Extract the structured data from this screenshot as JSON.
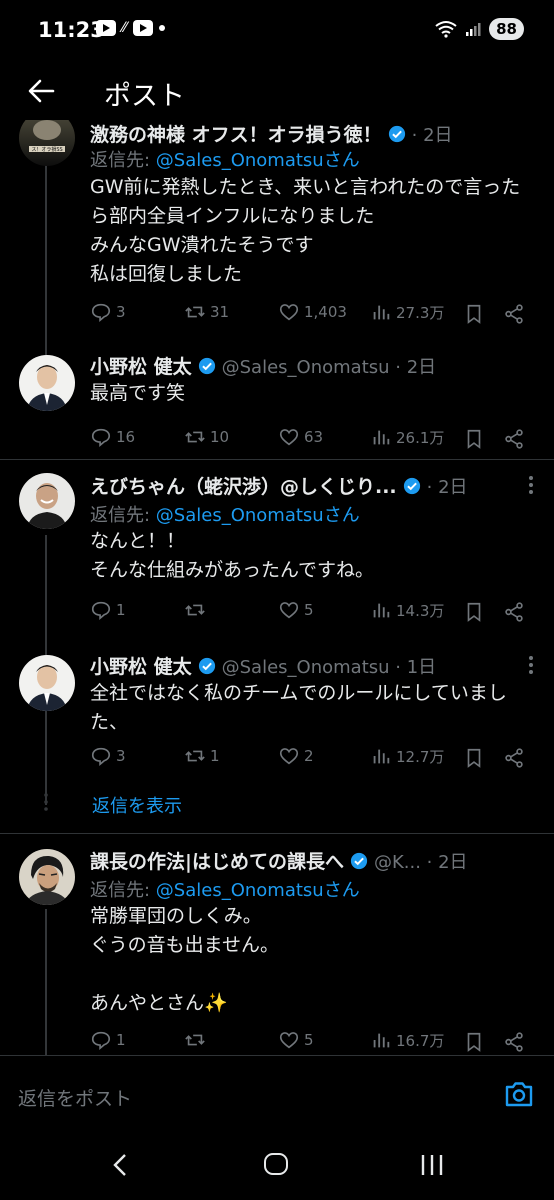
{
  "status_bar": {
    "time": "11:23",
    "battery": "88"
  },
  "header": {
    "title": "ポスト"
  },
  "tweets": [
    {
      "name": "激務の神様 オフス！オラ損う徳！",
      "time": "· 2日",
      "reply_label": "返信先: ",
      "reply_mention": "@Sales_Onomatsuさん",
      "body": "GW前に発熱したとき、来いと言われたので言ったら部内全員インフルになりました\nみんなGW潰れたそうです\n私は回復しました",
      "replies": "3",
      "retweets": "31",
      "likes": "1,403",
      "views": "27.3万"
    },
    {
      "name": "小野松 健太",
      "handle": "@Sales_Onomatsu · 2日",
      "body": "最高です笑",
      "replies": "16",
      "retweets": "10",
      "likes": "63",
      "views": "26.1万"
    },
    {
      "name": "えびちゃん（蛯沢渉）@しくじり...",
      "time": "· 2日",
      "reply_label": "返信先: ",
      "reply_mention": "@Sales_Onomatsuさん",
      "body": "なんと！！\nそんな仕組みがあったんですね。",
      "replies": "1",
      "retweets": "",
      "likes": "5",
      "views": "14.3万"
    },
    {
      "name": "小野松 健太",
      "handle": "@Sales_Onomatsu · 1日",
      "body": "全社ではなく私のチームでのルールにしていました、",
      "replies": "3",
      "retweets": "1",
      "likes": "2",
      "views": "12.7万"
    },
    {
      "name": "課長の作法|はじめての課長へ",
      "handle": "@K...  · 2日",
      "reply_label": "返信先: ",
      "reply_mention": "@Sales_Onomatsuさん",
      "body": "常勝軍団のしくみ。\nぐうの音も出ません。\n\nあんやとさん✨",
      "replies": "1",
      "retweets": "",
      "likes": "5",
      "views": "16.7万"
    }
  ],
  "show_replies": "返信を表示",
  "reply_bar": {
    "placeholder": "返信をポスト"
  },
  "colors": {
    "accent": "#1d9bf0",
    "muted": "#71767b",
    "text": "#e7e9ea",
    "background": "#000000"
  },
  "icons": [
    "back-arrow-icon",
    "verified-icon",
    "more-icon",
    "reply-icon",
    "retweet-icon",
    "like-icon",
    "views-icon",
    "bookmark-icon",
    "share-icon",
    "camera-icon"
  ]
}
